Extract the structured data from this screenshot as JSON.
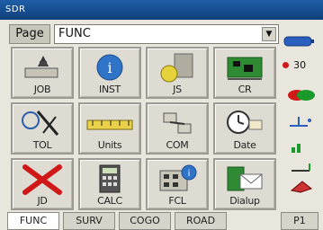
{
  "window": {
    "title": "SDR"
  },
  "page_selector": {
    "label": "Page",
    "value": "FUNC"
  },
  "tiles": [
    {
      "label": "JOB"
    },
    {
      "label": "INST"
    },
    {
      "label": "JS"
    },
    {
      "label": "CR"
    },
    {
      "label": "TOL"
    },
    {
      "label": "Units"
    },
    {
      "label": "COM"
    },
    {
      "label": "Date"
    },
    {
      "label": "JD"
    },
    {
      "label": "CALC"
    },
    {
      "label": "FCL"
    },
    {
      "label": "Dialup"
    }
  ],
  "status": {
    "count": "30"
  },
  "bottom_tabs": [
    {
      "label": "FUNC"
    },
    {
      "label": "SURV"
    },
    {
      "label": "COGO"
    },
    {
      "label": "ROAD"
    },
    {
      "label": "P1"
    }
  ],
  "colors": {
    "title_bar": "#1f5fa8",
    "accent_red": "#d01818",
    "accent_green": "#1a9a2a"
  }
}
